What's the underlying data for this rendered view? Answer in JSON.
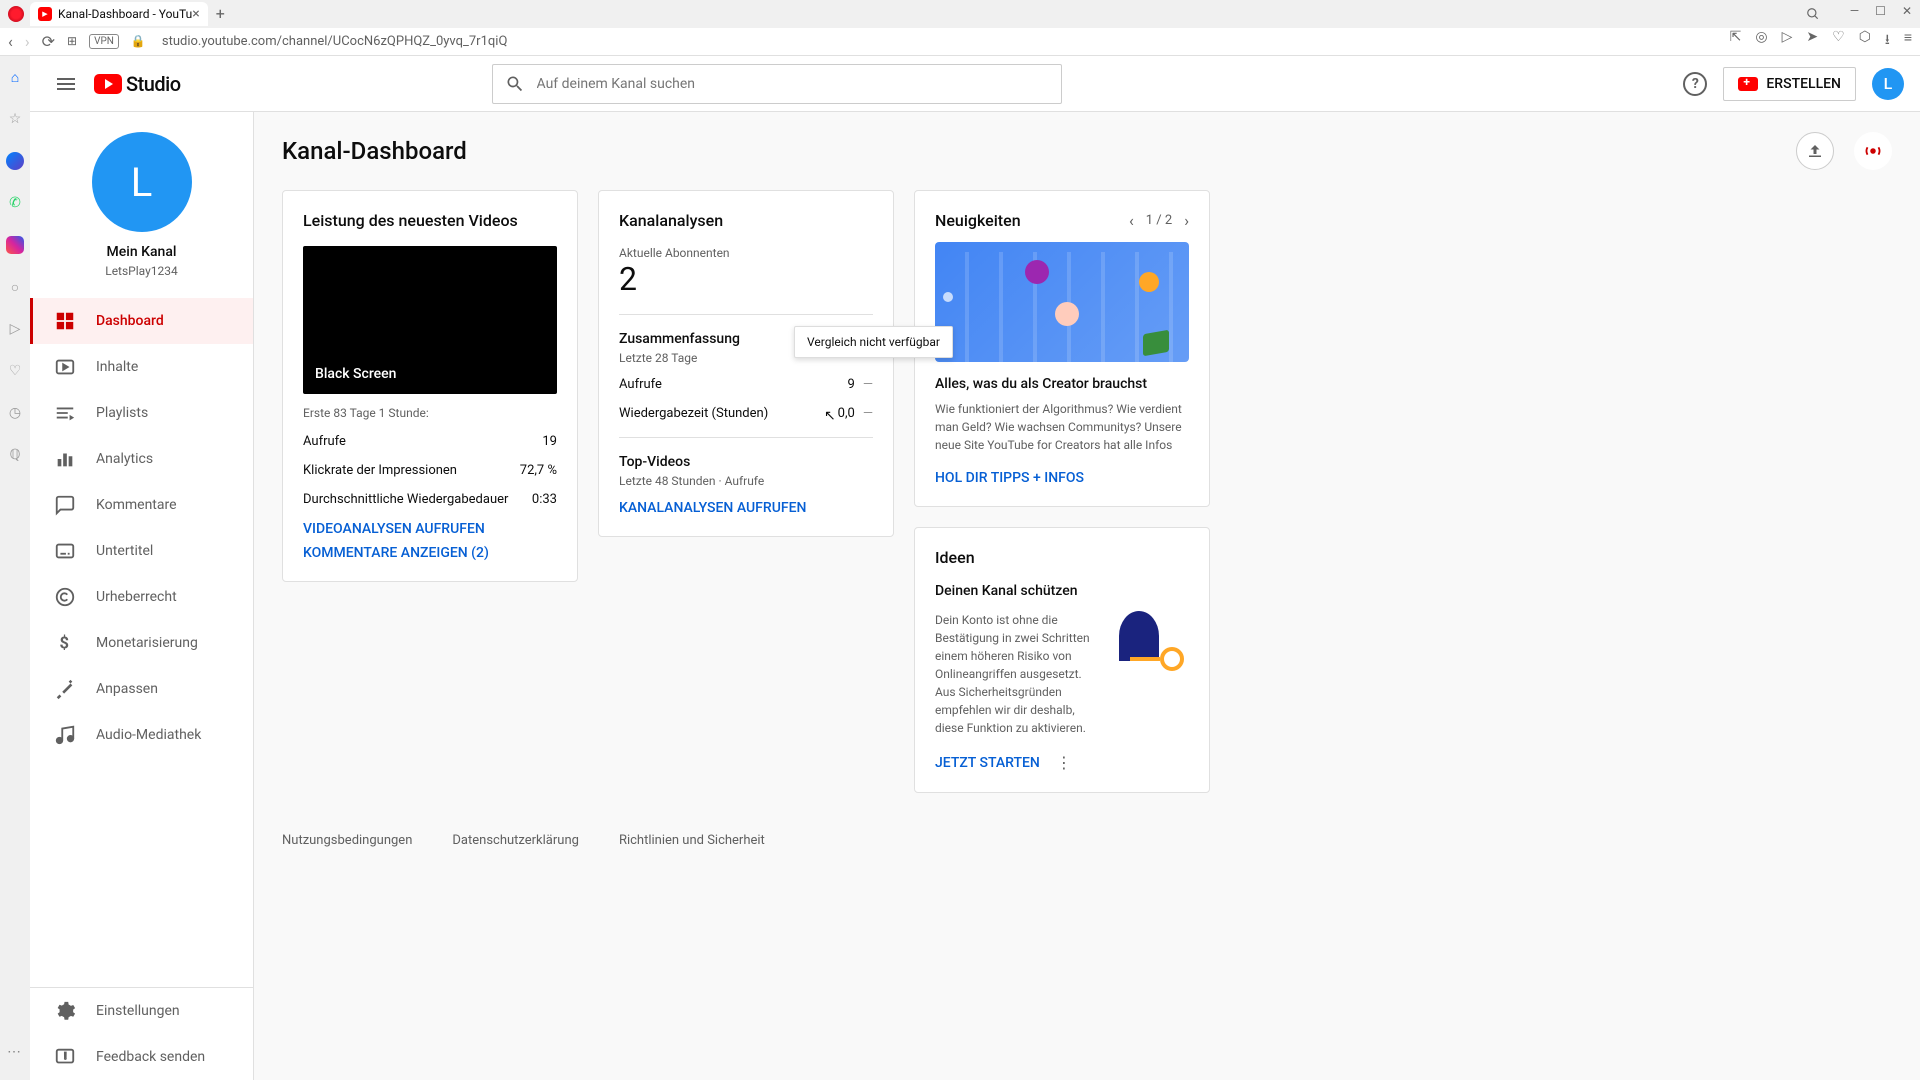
{
  "browser": {
    "tab_title": "Kanal-Dashboard - YouTu",
    "url": "studio.youtube.com/channel/UCocN6zQPHQZ_0yvq_7r1qiQ",
    "vpn": "VPN"
  },
  "header": {
    "logo_text": "Studio",
    "search_placeholder": "Auf deinem Kanal suchen",
    "create_label": "ERSTELLEN",
    "avatar_letter": "L"
  },
  "channel": {
    "avatar_letter": "L",
    "name_label": "Mein Kanal",
    "handle": "LetsPlay1234"
  },
  "nav": {
    "dashboard": "Dashboard",
    "inhalte": "Inhalte",
    "playlists": "Playlists",
    "analytics": "Analytics",
    "kommentare": "Kommentare",
    "untertitel": "Untertitel",
    "urheberrecht": "Urheberrecht",
    "monetarisierung": "Monetarisierung",
    "anpassen": "Anpassen",
    "audio": "Audio-Mediathek",
    "einstellungen": "Einstellungen",
    "feedback": "Feedback senden"
  },
  "page": {
    "title": "Kanal-Dashboard"
  },
  "latest_video": {
    "card_title": "Leistung des neuesten Videos",
    "video_title": "Black Screen",
    "meta": "Erste 83 Tage 1 Stunde:",
    "stats": {
      "aufrufe_label": "Aufrufe",
      "aufrufe_value": "19",
      "ctr_label": "Klickrate der Impressionen",
      "ctr_value": "72,7 %",
      "watchtime_label": "Durchschnittliche Wiedergabedauer",
      "watchtime_value": "0:33"
    },
    "link_analytics": "VIDEOANALYSEN AUFRUFEN",
    "link_comments": "KOMMENTARE ANZEIGEN (2)"
  },
  "analytics": {
    "card_title": "Kanalanalysen",
    "subs_label": "Aktuelle Abonnenten",
    "subs_value": "2",
    "summary_title": "Zusammenfassung",
    "summary_period": "Letzte 28 Tage",
    "views_label": "Aufrufe",
    "views_value": "9",
    "watch_label": "Wiedergabezeit (Stunden)",
    "watch_value": "0,0",
    "top_title": "Top-Videos",
    "top_period": "Letzte 48 Stunden · Aufrufe",
    "link": "KANALANALYSEN AUFRUFEN",
    "tooltip": "Vergleich nicht verfügbar"
  },
  "news": {
    "card_title": "Neuigkeiten",
    "pagination": "1 / 2",
    "title": "Alles, was du als Creator brauchst",
    "body": "Wie funktioniert der Algorithmus? Wie verdient man Geld? Wie wachsen Communitys? Unsere neue Site YouTube for Creators hat alle Infos",
    "link": "HOL DIR TIPPS + INFOS"
  },
  "ideas": {
    "card_title": "Ideen",
    "title": "Deinen Kanal schützen",
    "body": "Dein Konto ist ohne die Bestätigung in zwei Schritten einem höheren Risiko von Onlineangriffen ausgesetzt. Aus Sicherheitsgründen empfehlen wir dir deshalb, diese Funktion zu aktivieren.",
    "link": "JETZT STARTEN"
  },
  "footer": {
    "terms": "Nutzungsbedingungen",
    "privacy": "Datenschutzerklärung",
    "policy": "Richtlinien und Sicherheit"
  }
}
